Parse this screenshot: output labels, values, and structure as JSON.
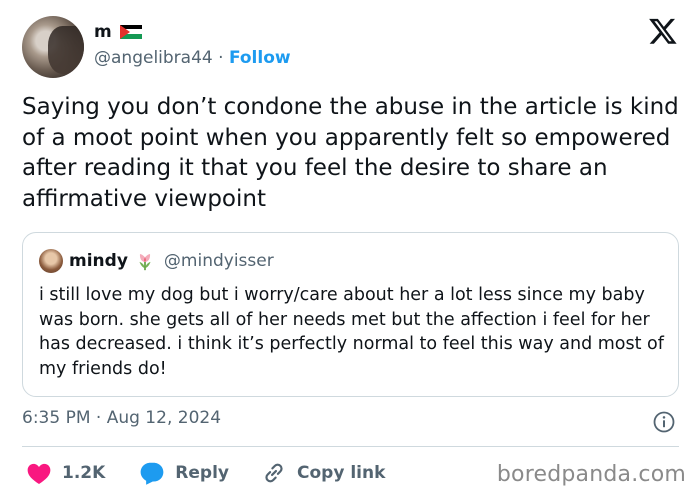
{
  "author": {
    "name": "m",
    "handle": "@angelibra44",
    "separator": "·",
    "follow_label": "Follow"
  },
  "tweet": {
    "text": "Saying you don’t condone the abuse in the article is kind of a moot point when you apparently felt so empowered after reading it that you feel the desire to share an affirmative viewpoint"
  },
  "quote": {
    "name": "mindy",
    "handle": "@mindyisser",
    "text": "i still love my dog but i worry/care about her a lot less since my baby was born. she gets all of her needs met but the affection i feel for her has decreased. i think it’s perfectly normal to feel this way and most of my friends do!"
  },
  "timestamp": "6:35 PM · Aug 12, 2024",
  "actions": {
    "likes": "1.2K",
    "reply_label": "Reply",
    "copy_link_label": "Copy link"
  },
  "watermark": "boredpanda.com",
  "icons": {
    "brand": "x-logo-icon",
    "flag": "palestine-flag-icon",
    "emoji": "tulip-icon",
    "info": "info-icon",
    "like": "heart-icon",
    "reply": "speech-bubble-icon",
    "copy": "link-icon"
  },
  "colors": {
    "text": "#0f1419",
    "muted": "#536471",
    "link": "#1d9bf0",
    "heart": "#f91880",
    "reply_bubble": "#1d9bf0",
    "border": "#cfd9de"
  }
}
